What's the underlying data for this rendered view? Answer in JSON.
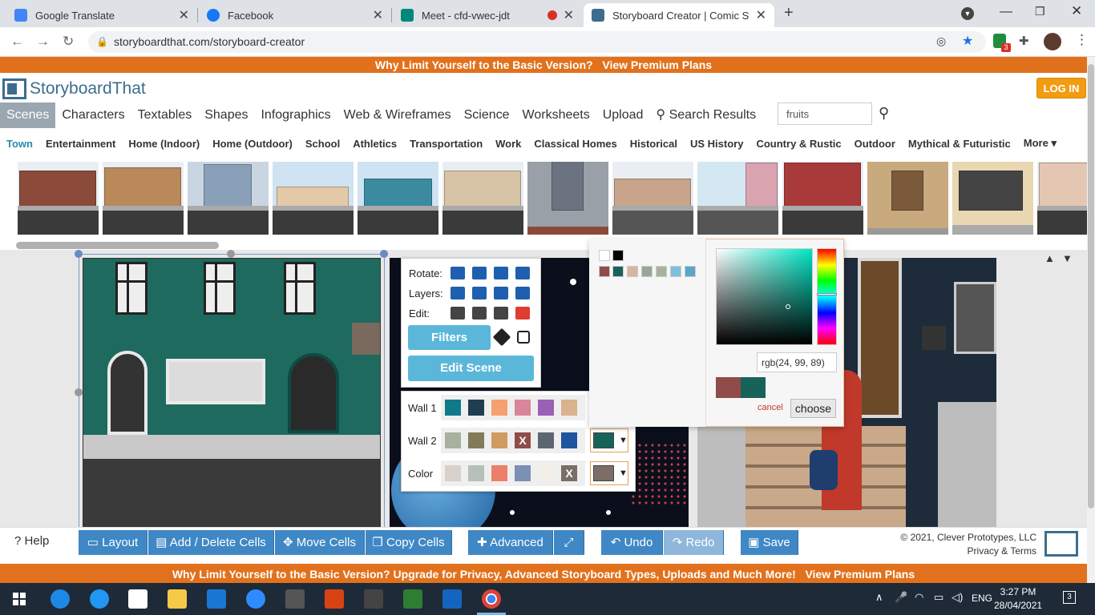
{
  "browser": {
    "tabs": [
      {
        "title": "Google Translate",
        "color": "#4285f4"
      },
      {
        "title": "Facebook",
        "color": "#1877f2"
      },
      {
        "title": "Meet - cfd-vwec-jdt",
        "color": "#00897b"
      },
      {
        "title": "Storyboard Creator | Comic Strip",
        "color": "#3d6d8e"
      }
    ],
    "url": "storyboardthat.com/storyboard-creator"
  },
  "banner_top": {
    "text": "Why Limit Yourself to the Basic Version?",
    "link": "View Premium Plans"
  },
  "logo": {
    "text": "StoryboardThat"
  },
  "login_label": "LOG IN",
  "categories": [
    "Scenes",
    "Characters",
    "Textables",
    "Shapes",
    "Infographics",
    "Web & Wireframes",
    "Science",
    "Worksheets",
    "Upload",
    "Search Results"
  ],
  "search": {
    "value": "fruits"
  },
  "subcategories": [
    "Town",
    "Entertainment",
    "Home (Indoor)",
    "Home (Outdoor)",
    "School",
    "Athletics",
    "Transportation",
    "Work",
    "Classical Homes",
    "Historical",
    "US History",
    "Country & Rustic",
    "Outdoor",
    "Mythical & Futuristic",
    "More"
  ],
  "tools": {
    "rotate_label": "Rotate:",
    "layers_label": "Layers:",
    "edit_label": "Edit:",
    "filters_label": "Filters",
    "edit_scene_label": "Edit Scene"
  },
  "color_panel": {
    "rows": [
      {
        "label": "Wall 1",
        "swatches": [
          "#0e7a8a",
          "#1f3e4f",
          "#f4a070",
          "#d9859b",
          "#9b5fb5",
          "#d9b28f"
        ],
        "current": null
      },
      {
        "label": "Wall 2",
        "swatches": [
          "#a8b09e",
          "#837a5a",
          "#d19a5e",
          "x",
          "#5b6670",
          "#1f55a0"
        ],
        "current": "#186359"
      },
      {
        "label": "Color",
        "swatches": [
          "#d9d0ca",
          "#b6c0b9",
          "#ec7f6a",
          "#7b90b3",
          "#f2efe6",
          "x"
        ],
        "current": "#7a6e66"
      }
    ],
    "x_label": "X"
  },
  "picker": {
    "swatches_row1": [
      "#ffffff",
      "#000000"
    ],
    "swatches_row2": [
      "#8f4c4a",
      "#186359",
      "#d8b59c",
      "#9aa59a",
      "#a9b09f",
      "#7ec0d9",
      "#5ba5c9"
    ],
    "rgb_value": "rgb(24, 99, 89)",
    "old_color": "#8f4c4a",
    "new_color": "#186359",
    "cancel_label": "cancel",
    "choose_label": "choose"
  },
  "bottom": {
    "help_label": "Help",
    "buttons": [
      "Layout",
      "Add / Delete Cells",
      "Move Cells",
      "Copy Cells",
      "Advanced",
      "Undo",
      "Redo",
      "Save"
    ],
    "copyright": "© 2021, Clever Prototypes, LLC",
    "privacy": "Privacy & Terms"
  },
  "banner_bottom": {
    "text": "Why Limit Yourself to the Basic Version? Upgrade for Privacy, Advanced Storyboard Types, Uploads and Much More!",
    "link": "View Premium Plans"
  },
  "taskbar": {
    "lang": "ENG",
    "time": "3:27 PM",
    "date": "28/04/2021",
    "notif_count": "3"
  }
}
